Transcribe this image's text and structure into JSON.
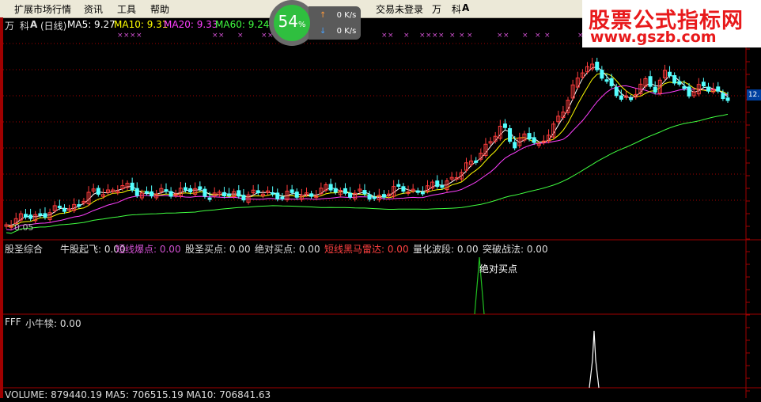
{
  "menu": {
    "items": [
      "扩展市场行情",
      "资讯",
      "工具",
      "帮助"
    ],
    "login_status": "交易未登录",
    "wan": "万",
    "ke": "科",
    "ke_icon": "A-glyph"
  },
  "speed": {
    "percent": "54",
    "percent_unit": "%",
    "upload": "0",
    "download": "0",
    "unit": "K/s"
  },
  "watermark": {
    "cn": "股票公式指标网",
    "url": "www.gszb.com"
  },
  "main_info": {
    "wan": "万",
    "name": "科",
    "period": "(日线)",
    "ma5": "MA5: 9.27",
    "ma10": "MA10: 9.31",
    "ma20": "MA20: 9.33",
    "ma60": "MA60: 9.24"
  },
  "price_label": "12.",
  "min_label": "0.05",
  "ind1": {
    "title": "股圣综合",
    "items": [
      {
        "text": "牛股起飞: 0.00",
        "color": "#dddddd"
      },
      {
        "text": "短线爆点: 0.00",
        "color": "#d050d0"
      },
      {
        "text": "股圣买点: 0.00",
        "color": "#dddddd"
      },
      {
        "text": "绝对买点: 0.00",
        "color": "#dddddd"
      },
      {
        "text": "短线黑马雷达: 0.00",
        "color": "#ff4040"
      },
      {
        "text": "量化波段: 0.00",
        "color": "#dddddd"
      },
      {
        "text": "突破战法: 0.00",
        "color": "#dddddd"
      }
    ],
    "peak_label": "绝对买点"
  },
  "ind2": {
    "title": "FFF",
    "item": "小牛犊: 0.00"
  },
  "volume": {
    "text": "VOLUME: 879440.19  MA5: 706515.19  MA10: 706841.63"
  },
  "colors": {
    "up": "#ff3c3c",
    "down": "#54ffff",
    "ma5": "#ffffff",
    "ma10": "#ffff00",
    "ma20": "#ff40ff",
    "ma60": "#40ff40",
    "grid": "#a00000",
    "signal_green": "#20c020"
  }
}
